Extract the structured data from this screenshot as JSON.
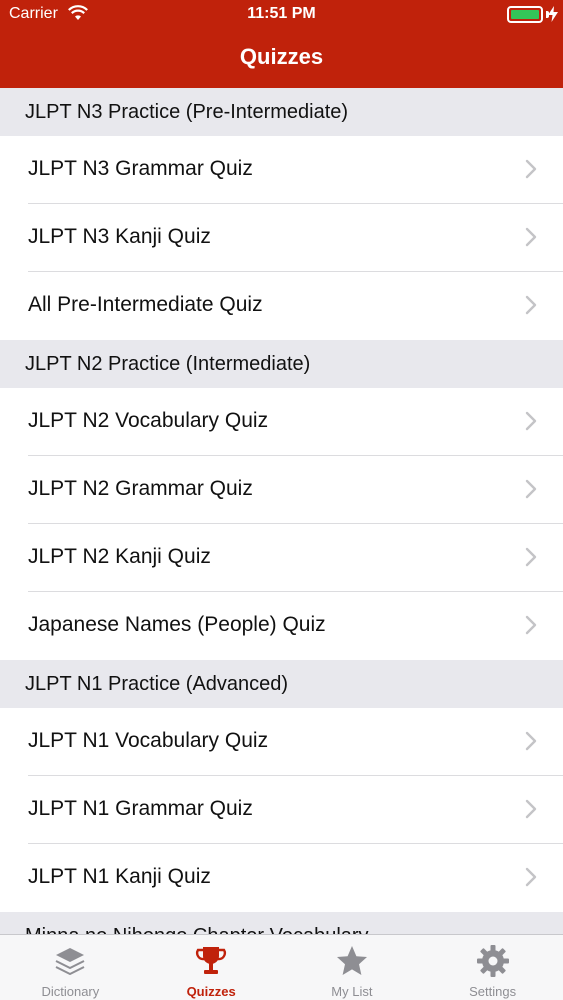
{
  "status_bar": {
    "carrier": "Carrier",
    "time": "11:51 PM"
  },
  "nav": {
    "title": "Quizzes"
  },
  "sections": [
    {
      "header": "JLPT N3 Practice (Pre-Intermediate)",
      "items": [
        "JLPT N3 Grammar Quiz",
        "JLPT N3 Kanji Quiz",
        "All Pre-Intermediate Quiz"
      ]
    },
    {
      "header": "JLPT N2 Practice (Intermediate)",
      "items": [
        "JLPT N2 Vocabulary Quiz",
        "JLPT N2 Grammar Quiz",
        "JLPT N2 Kanji Quiz",
        "Japanese Names (People) Quiz"
      ]
    },
    {
      "header": "JLPT N1 Practice (Advanced)",
      "items": [
        "JLPT N1 Vocabulary Quiz",
        "JLPT N1 Grammar Quiz",
        "JLPT N1 Kanji Quiz"
      ]
    },
    {
      "header": "Minna no Nihongo Chapter Vocabulary",
      "items": []
    }
  ],
  "tabbar": {
    "tabs": [
      {
        "label": "Dictionary",
        "icon": "layers-icon"
      },
      {
        "label": "Quizzes",
        "icon": "trophy-icon"
      },
      {
        "label": "My List",
        "icon": "star-icon"
      },
      {
        "label": "Settings",
        "icon": "gear-icon"
      }
    ]
  },
  "colors": {
    "accent": "#c0220b",
    "section_bg": "#e8e8ed",
    "inactive": "#8e8e93",
    "battery": "#34c759"
  }
}
